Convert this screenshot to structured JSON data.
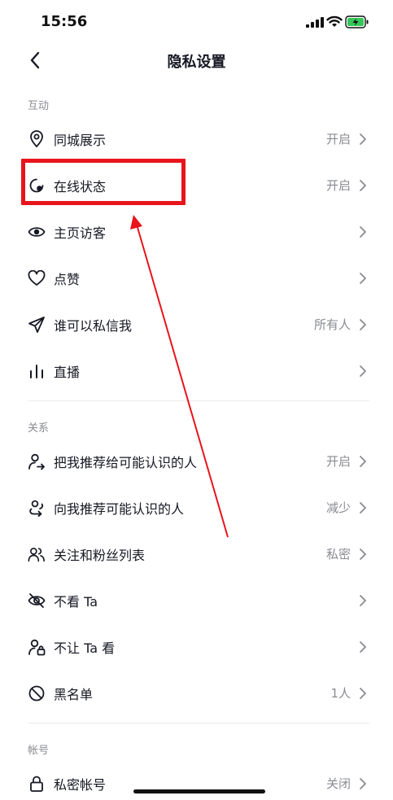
{
  "status_bar": {
    "time": "15:56"
  },
  "nav": {
    "title": "隐私设置"
  },
  "sections": [
    {
      "header": "互动",
      "items": [
        {
          "icon": "location-pin-icon",
          "label": "同城展示",
          "value": "开启"
        },
        {
          "icon": "online-status-icon",
          "label": "在线状态",
          "value": "开启"
        },
        {
          "icon": "eye-icon",
          "label": "主页访客",
          "value": ""
        },
        {
          "icon": "heart-icon",
          "label": "点赞",
          "value": ""
        },
        {
          "icon": "paper-plane-icon",
          "label": "谁可以私信我",
          "value": "所有人"
        },
        {
          "icon": "live-bars-icon",
          "label": "直播",
          "value": ""
        }
      ]
    },
    {
      "header": "关系",
      "items": [
        {
          "icon": "user-share-icon",
          "label": "把我推荐给可能认识的人",
          "value": "开启"
        },
        {
          "icon": "recommend-loop-icon",
          "label": "向我推荐可能认识的人",
          "value": "减少"
        },
        {
          "icon": "followers-icon",
          "label": "关注和粉丝列表",
          "value": "私密"
        },
        {
          "icon": "eye-off-icon",
          "label": "不看 Ta",
          "value": ""
        },
        {
          "icon": "user-lock-icon",
          "label": "不让 Ta 看",
          "value": ""
        },
        {
          "icon": "block-icon",
          "label": "黑名单",
          "value": "1人"
        }
      ]
    },
    {
      "header": "帐号",
      "items": [
        {
          "icon": "lock-icon",
          "label": "私密帐号",
          "value": "关闭"
        }
      ]
    }
  ],
  "annotation": {
    "color": "#e8141c"
  }
}
